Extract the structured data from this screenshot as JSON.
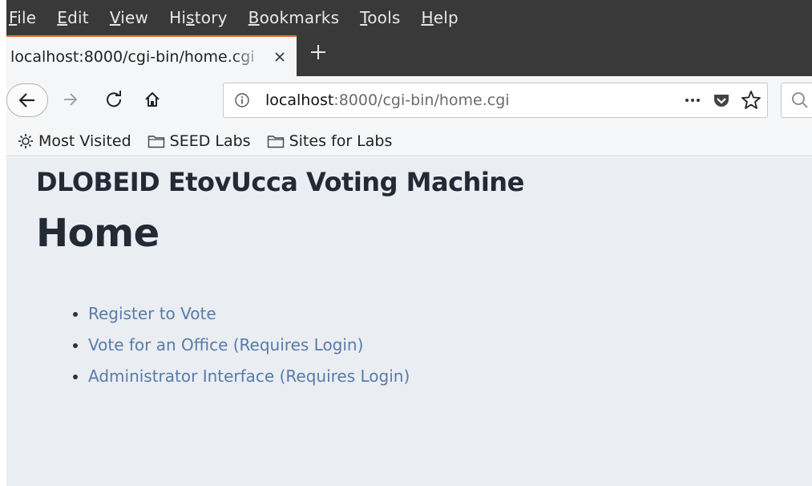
{
  "menubar": {
    "items": [
      {
        "pre": "",
        "mnemonic": "F",
        "post": "ile"
      },
      {
        "pre": "",
        "mnemonic": "E",
        "post": "dit"
      },
      {
        "pre": "",
        "mnemonic": "V",
        "post": "iew"
      },
      {
        "pre": "Hi",
        "mnemonic": "s",
        "post": "tory"
      },
      {
        "pre": "",
        "mnemonic": "B",
        "post": "ookmarks"
      },
      {
        "pre": "",
        "mnemonic": "T",
        "post": "ools"
      },
      {
        "pre": "",
        "mnemonic": "H",
        "post": "elp"
      }
    ]
  },
  "tab": {
    "title": "localhost:8000/cgi-bin/home.cgi",
    "close_icon": "close-icon",
    "new_tab_icon": "plus-icon"
  },
  "navbar": {
    "url_host": "localhost",
    "url_rest": ":8000/cgi-bin/home.cgi",
    "icons": [
      "back-arrow-icon",
      "forward-arrow-icon",
      "reload-icon",
      "home-icon",
      "info-icon",
      "more-icon",
      "pocket-icon",
      "star-icon",
      "search-icon"
    ]
  },
  "bookmarks": {
    "items": [
      {
        "label": "Most Visited",
        "icon": "gear-icon"
      },
      {
        "label": "SEED Labs",
        "icon": "folder-icon"
      },
      {
        "label": "Sites for Labs",
        "icon": "folder-icon"
      }
    ]
  },
  "page": {
    "site_title": "DLOBEID EtovUcca Voting Machine",
    "heading": "Home",
    "links": [
      "Register to Vote",
      "Vote for an Office (Requires Login)",
      "Administrator Interface (Requires Login)"
    ],
    "colors": {
      "background": "#eaedf2",
      "heading": "#222a35",
      "link": "#587ca8"
    }
  }
}
